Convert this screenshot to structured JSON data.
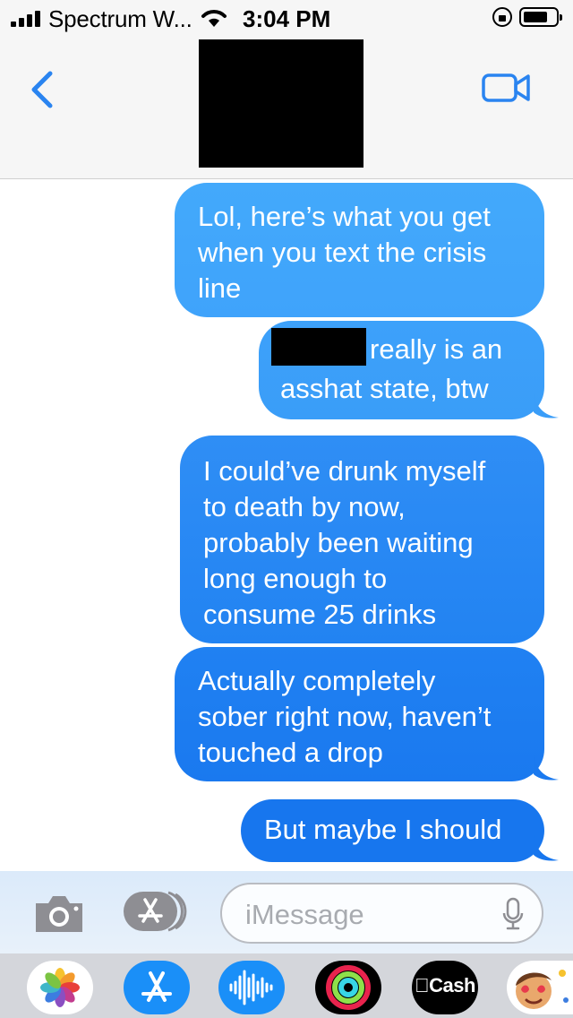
{
  "status_bar": {
    "carrier": "Spectrum W...",
    "time": "3:04 PM"
  },
  "header": {
    "contact_redacted": true
  },
  "messages": [
    {
      "id": "msg1",
      "sender": "me",
      "text": "Lol, here’s what you get\nwhen you text the crisis\nline"
    },
    {
      "id": "msg2",
      "sender": "me",
      "text_line1": "really is an",
      "text_line2": "asshat state, btw",
      "has_redaction": true
    },
    {
      "id": "msg3",
      "sender": "me",
      "text": "I could’ve drunk myself\nto death by now,\nprobably been waiting\nlong enough to\nconsume 25 drinks"
    },
    {
      "id": "msg4",
      "sender": "me",
      "text": "Actually completely\nsober right now, haven’t\ntouched a drop"
    },
    {
      "id": "msg5",
      "sender": "me",
      "text": "But maybe I should"
    }
  ],
  "input_bar": {
    "placeholder": "iMessage"
  },
  "app_drawer": {
    "apps": [
      "photos-icon",
      "app-store-icon",
      "audio-message-icon",
      "activity-icon",
      "cash-app-icon",
      "memoji-icon"
    ],
    "cash_label": "Cash"
  },
  "colors": {
    "bubble_top": "#43a9fb",
    "bubble_bottom": "#1776ee",
    "ios_blue": "#2a84f0"
  }
}
